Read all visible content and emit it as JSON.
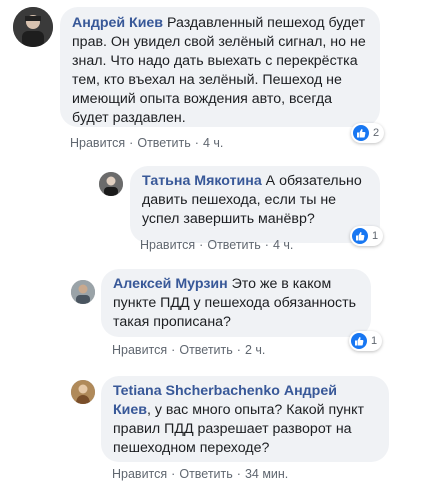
{
  "comments": [
    {
      "author": "Андрей Киев",
      "text": " Раздавленный пешеход будет прав. Он увидел свой зелёный сигнал, но не знал. Что надо дать выехать с перекрёстка тем, кто въехал на зелёный. Пешеход не имеющий опыта вождения авто, всегда будет раздавлен.",
      "like_label": "Нравится",
      "reply_label": "Ответить",
      "time": "4 ч.",
      "reactions": "2"
    },
    {
      "author": "Татьна Мякотина",
      "text": " А обязательно давить пешехода, если ты не успел завершить манёвр?",
      "like_label": "Нравится",
      "reply_label": "Ответить",
      "time": "4 ч.",
      "reactions": "1"
    },
    {
      "author": "Алексей Мурзин",
      "text": " Это же в каком пункте ПДД у пешехода обязанность такая прописана?",
      "like_label": "Нравится",
      "reply_label": "Ответить",
      "time": "2 ч.",
      "reactions": "1"
    },
    {
      "author": "Tetiana Shcherbachenko",
      "mention": "Андрей Киев",
      "text": ", у вас много опыта? Какой пункт правил ПДД разрешает разворот на пешеходном переходе?",
      "like_label": "Нравится",
      "reply_label": "Ответить",
      "time": "34 мин."
    }
  ],
  "colors": {
    "author": "#385898",
    "bubble": "#f0f2f5",
    "meta": "#606770",
    "like_blue": "#1877f2"
  }
}
